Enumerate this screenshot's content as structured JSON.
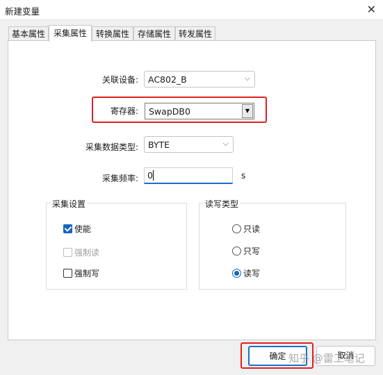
{
  "window": {
    "title": "新建变量",
    "close_icon": "close-icon"
  },
  "tabs": [
    {
      "label": "基本属性",
      "active": false
    },
    {
      "label": "采集属性",
      "active": true
    },
    {
      "label": "转换属性",
      "active": false
    },
    {
      "label": "存储属性",
      "active": false
    },
    {
      "label": "转发属性",
      "active": false
    }
  ],
  "form": {
    "device": {
      "label": "关联设备:",
      "value": "AC802_B"
    },
    "register": {
      "label": "寄存器:",
      "value": "SwapDB0"
    },
    "data_type": {
      "label": "采集数据类型:",
      "value": "BYTE"
    },
    "frequency": {
      "label": "采集频率:",
      "value": "0",
      "unit": "s"
    }
  },
  "collect_settings": {
    "title": "采集设置",
    "enable": {
      "label": "使能",
      "checked": true
    },
    "force_read": {
      "label": "强制读",
      "checked": false,
      "disabled": true
    },
    "force_write": {
      "label": "强制写",
      "checked": false
    }
  },
  "rw_type": {
    "title": "读写类型",
    "options": [
      {
        "label": "只读",
        "selected": false
      },
      {
        "label": "只写",
        "selected": false
      },
      {
        "label": "读写",
        "selected": true
      }
    ]
  },
  "buttons": {
    "ok": "确定",
    "cancel": "取消"
  },
  "watermark": "知乎 @雷工笔记",
  "colors": {
    "accent": "#1565c0",
    "highlight_box": "#e02020"
  }
}
